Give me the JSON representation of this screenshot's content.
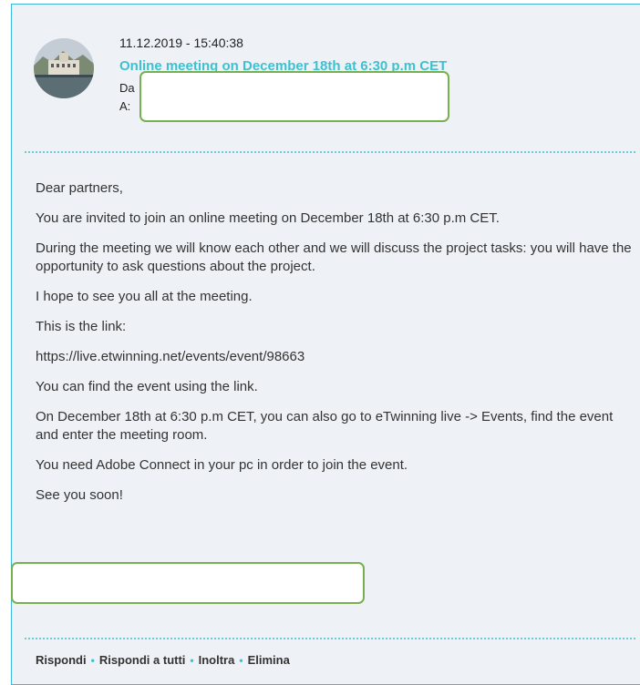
{
  "message": {
    "timestamp": "11.12.2019 - 15:40:38",
    "subject": "Online meeting on December 18th at 6:30 p.m CET",
    "from_label": "Da",
    "to_label": "A:"
  },
  "body": {
    "paragraphs": [
      "Dear partners,",
      "You are invited to join an online meeting on December 18th at 6:30 p.m CET.",
      "During the meeting we will know each other and we will discuss the project tasks: you will have the opportunity to ask questions about the project.",
      "I hope to see you all  at the meeting.",
      "This is the link:",
      "https://live.etwinning.net/events/event/98663",
      "You can find the event using the link.",
      "On December 18th at 6:30 p.m CET, you can also go to eTwinning live -> Events, find the event and enter the meeting room.",
      "You need Adobe Connect in your pc in order to join the event.",
      "See you soon!"
    ]
  },
  "actions": {
    "reply": "Rispondi",
    "reply_all": "Rispondi a tutti",
    "forward": "Inoltra",
    "delete": "Elimina",
    "separator": "•"
  },
  "colors": {
    "accent": "#3ec1cf",
    "border": "#3fb8e0",
    "redaction_outline": "#78b04f",
    "panel_background": "#eef2f6"
  },
  "icons": {
    "avatar": "sender-avatar-photo"
  }
}
